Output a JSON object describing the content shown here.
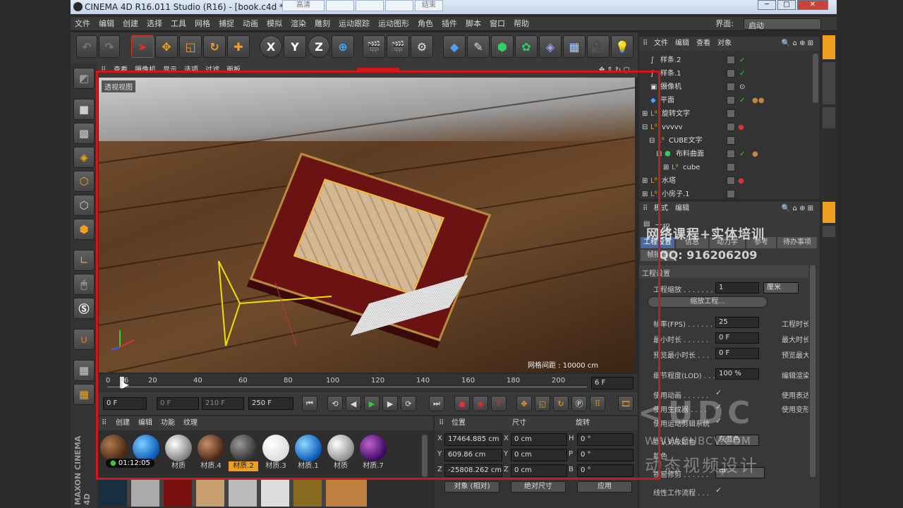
{
  "titlebar": {
    "title": "CINEMA 4D R16.011 Studio (R16) - [book.c4d *]",
    "tabs": [
      "高清",
      "",
      "",
      "结束"
    ],
    "win_minimize": "─",
    "win_maximize": "□",
    "win_close": "✕"
  },
  "menubar": {
    "items": [
      "文件",
      "编辑",
      "创建",
      "选择",
      "工具",
      "网格",
      "捕捉",
      "动画",
      "模拟",
      "渲染",
      "雕刻",
      "运动跟踪",
      "运动图形",
      "角色",
      "插件",
      "脚本",
      "窗口",
      "帮助"
    ],
    "interface_label": "界面:",
    "interface_value": "启动"
  },
  "toolbar": {
    "x": "X",
    "y": "Y",
    "z": "Z"
  },
  "viewport": {
    "menu": [
      "查看",
      "摄像机",
      "显示",
      "选项",
      "过滤",
      "面板"
    ],
    "label": "透视视图",
    "grid_spacing": "网格间距 : 10000 cm",
    "watermark": "网络课程+实体培训",
    "watermark_qq": "QQ: 916206209"
  },
  "timeline": {
    "ticks": [
      "0",
      "6",
      "20",
      "40",
      "60",
      "80",
      "100",
      "120",
      "140",
      "160",
      "180",
      "200"
    ],
    "current_frame": "6 F"
  },
  "transport": {
    "start": "0 F",
    "range_start": "0 F",
    "range_end": "210 F",
    "end": "250 F"
  },
  "materials": {
    "menu": [
      "创建",
      "编辑",
      "功能",
      "纹理"
    ],
    "items": [
      {
        "label": "",
        "color": "radial-gradient(circle at 35% 35%,#b07a50,#4a2a14 70%)"
      },
      {
        "label": "",
        "color": "radial-gradient(circle at 35% 35%,#7fd0ff,#0a5ab8 70%)"
      },
      {
        "label": "材质",
        "color": "radial-gradient(circle at 35% 35%,#fff,#777 75%)"
      },
      {
        "label": "材质.4",
        "color": "radial-gradient(circle at 35% 35%,#c9906a,#4a2414 70%)"
      },
      {
        "label": "材质.2",
        "color": "radial-gradient(circle at 35% 35%,#999,#333 70%)"
      },
      {
        "label": "材质.3",
        "color": "radial-gradient(circle at 35% 35%,#fff,#ddd 70%)"
      },
      {
        "label": "材质.1",
        "color": "radial-gradient(circle at 35% 35%,#8fd8ff,#0a5ab8 70%)"
      },
      {
        "label": "材质",
        "color": "radial-gradient(circle at 35% 35%,#fff,#888 75%)"
      },
      {
        "label": "材质.7",
        "color": "radial-gradient(circle at 35% 35%,#c060d0,#3a0a60 70%)"
      }
    ],
    "timestamp": "01:12:05"
  },
  "coords": {
    "headers": [
      "位置",
      "尺寸",
      "旋转"
    ],
    "x": "17464.885 cm",
    "y": "609.86 cm",
    "z": "-25808.262 cm",
    "sx": "0 cm",
    "sy": "0 cm",
    "sz": "0 cm",
    "h": "0 °",
    "p": "0 °",
    "b": "0 °",
    "mode": "对象 (相对)",
    "size_mode": "绝对尺寸",
    "apply": "应用"
  },
  "objects": {
    "menu": [
      "文件",
      "编辑",
      "查看",
      "对象"
    ],
    "items": [
      "样条.2",
      "样条.1",
      "摄像机",
      "平面",
      "旋转文字",
      "vvvvv",
      "CUBE文字",
      "布料曲面",
      "cube",
      "水塔",
      "小房子.1"
    ]
  },
  "attributes": {
    "menu": [
      "模式",
      "编辑"
    ],
    "section": "工程",
    "tabs": [
      "工程设置",
      "信息",
      "动力学",
      "参考",
      "待办事项"
    ],
    "extra_tab": "帧插值",
    "heading": "工程设置",
    "scale_label": "工程缩放 . . . . . . .",
    "scale_value": "1",
    "scale_unit": "厘米",
    "scale_button": "缩放工程...",
    "fps_label": "帧率(FPS) . . . . . .",
    "fps_value": "25",
    "project_time_label": "工程时长",
    "min_time_label": "最小时长 . . . . . .",
    "min_time_value": "0 F",
    "max_time_label": "最大时长",
    "preview_min_label": "预览最小时长 . . .",
    "preview_min_value": "0 F",
    "preview_max_label": "预览最大",
    "lod_label": "细节程度(LOD) . . .",
    "lod_value": "100 %",
    "editor_label": "编辑渲染",
    "use_anim": "使用动画 . . . . . .",
    "use_gen": "使用生成器 . . . .",
    "use_motion": "使用运动剪辑系统",
    "use_expr": "使用表达",
    "use_deform": "使用变形",
    "default_color_label": "默认对象颜色",
    "default_color_value": "灰蓝色",
    "color_label": "颜色",
    "clip_label": "视窗修剪 . . . . . .",
    "clip_value": "中",
    "linear_label": "线性工作流程 . . ."
  },
  "watermark": {
    "url": "WWW.CUBCV.COM",
    "brand": "动态视频设计"
  }
}
